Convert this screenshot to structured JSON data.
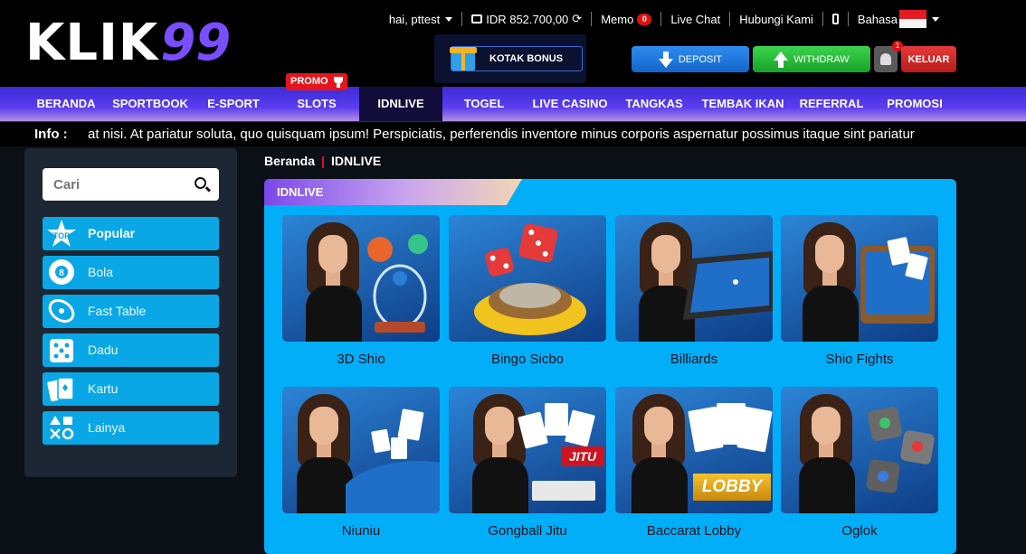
{
  "brand": {
    "logo_text": "KLIK",
    "logo_num": "99"
  },
  "topbar": {
    "greeting": "hai, pttest",
    "balance": "IDR 852.700,00",
    "memo_label": "Memo",
    "memo_count": "0",
    "live_chat": "Live Chat",
    "contact": "Hubungi Kami",
    "language_label": "Bahasa"
  },
  "actions": {
    "bonus_label": "KOTAK BONUS",
    "deposit_label": "DEPOSIT",
    "withdraw_label": "WITHDRAW",
    "notif_count": "1",
    "logout_label": "KELUAR"
  },
  "nav": {
    "promo_badge": "PROMO",
    "items": [
      "BERANDA",
      "SPORTBOOK",
      "E-SPORT",
      "SLOTS",
      "IDNLIVE",
      "TOGEL",
      "LIVE CASINO",
      "TANGKAS",
      "TEMBAK IKAN",
      "REFERRAL",
      "PROMOSI"
    ],
    "active": "IDNLIVE"
  },
  "info": {
    "label": "Info :",
    "text": "at nisi. At pariatur soluta, quo quisquam ipsum! Perspiciatis, perferendis inventore minus corporis aspernatur possimus itaque sint pariatur"
  },
  "sidebar": {
    "search_placeholder": "Cari",
    "categories": [
      {
        "label": "Popular",
        "icon": "top-icon"
      },
      {
        "label": "Bola",
        "icon": "ball-8-icon"
      },
      {
        "label": "Fast Table",
        "icon": "table-icon"
      },
      {
        "label": "Dadu",
        "icon": "dice-icon"
      },
      {
        "label": "Kartu",
        "icon": "cards-icon"
      },
      {
        "label": "Lainya",
        "icon": "shapes-icon"
      }
    ]
  },
  "breadcrumb": {
    "home": "Beranda",
    "current": "IDNLIVE"
  },
  "panel": {
    "tab_label": "IDNLIVE",
    "games": [
      {
        "name": "3D Shio"
      },
      {
        "name": "Bingo Sicbo"
      },
      {
        "name": "Billiards"
      },
      {
        "name": "Shio Fights"
      },
      {
        "name": "Niuniu"
      },
      {
        "name": "Gongball Jitu",
        "tag": "JITU"
      },
      {
        "name": "Baccarat Lobby",
        "tag": "LOBBY"
      },
      {
        "name": "Oglok"
      }
    ]
  },
  "colors": {
    "accent_blue": "#02aef8",
    "nav_purple": "#4a33e0",
    "promo_red": "#e8141c"
  }
}
